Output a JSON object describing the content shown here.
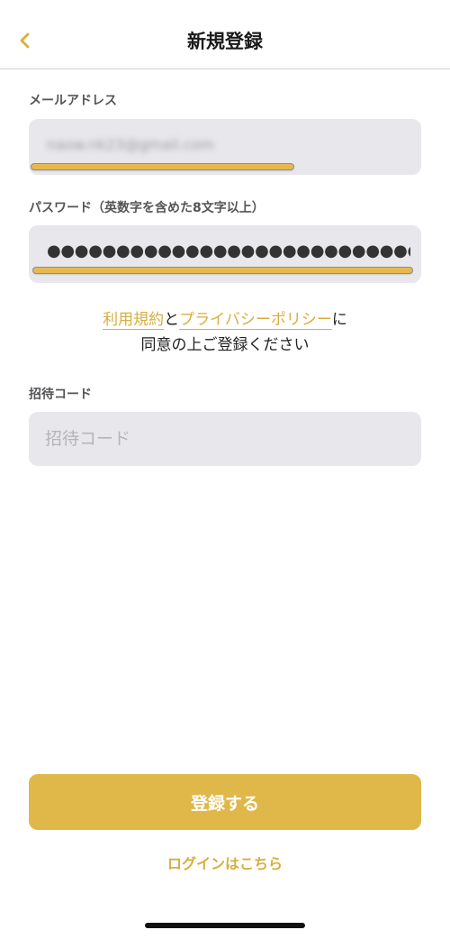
{
  "header": {
    "title": "新規登録",
    "back_icon": "chevron-left-icon"
  },
  "email": {
    "label": "メールアドレス",
    "value": "naow.nk23@gmail.com"
  },
  "password": {
    "label": "パスワード（英数字を含めた8文字以上）",
    "masked_value": "●●●●●●●●●●●●●●●●●●●●●●●●●●●●●●●●●●…"
  },
  "consent": {
    "terms_link": "利用規約",
    "connector": "と",
    "privacy_link": "プライバシーポリシー",
    "suffix": "に",
    "line2": "同意の上ご登録ください"
  },
  "invite": {
    "label": "招待コード",
    "placeholder": "招待コード",
    "value": ""
  },
  "submit_label": "登録する",
  "login_link": "ログインはこちら",
  "colors": {
    "accent": "#e0b84a",
    "link": "#d8ae3f",
    "field_bg": "#e8e8ec"
  }
}
